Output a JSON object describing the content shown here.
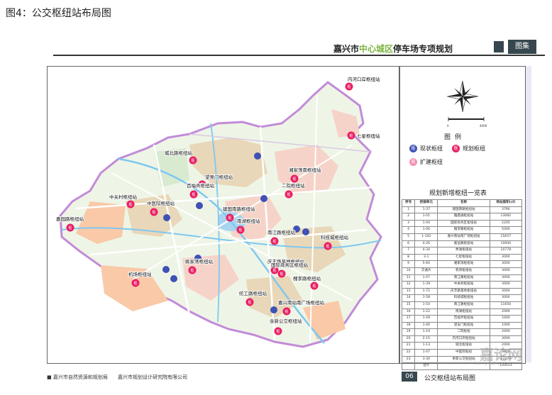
{
  "caption": "图4：公交枢纽站布局图",
  "header": {
    "title_prefix": "嘉兴市",
    "title_highlight": "中心城区",
    "title_suffix": "停车场专项规划",
    "tab_label": "图集",
    "highlight_color": "#7cb342",
    "dark_color": "#37474f"
  },
  "compass": {
    "scale_left": "0",
    "scale_right": "4000"
  },
  "legend": {
    "title": "图例",
    "items": [
      {
        "label": "现状枢纽",
        "color": "#3f51b5",
        "glyph": "枢"
      },
      {
        "label": "规划枢纽",
        "color": "#e91e63",
        "glyph": "枢"
      },
      {
        "label": "扩建枢纽",
        "color": "#f48fb1",
        "glyph": "枢"
      }
    ]
  },
  "table": {
    "title": "规划新增枢纽一览表",
    "columns": [
      "序号",
      "控规单元",
      "名称",
      "场站面积(㎡)"
    ],
    "rows": [
      [
        "1",
        "1-37",
        "建国南路枢纽站",
        "3790"
      ],
      [
        "2",
        "1-01",
        "雅鹿通枢纽站",
        "13082"
      ],
      [
        "3",
        "1-04",
        "国际商务区枢纽站",
        "2205"
      ],
      [
        "4",
        "1-06",
        "槐李路枢纽站",
        "5000"
      ],
      [
        "5",
        "1-102",
        "嘉兴南站南广场枢纽站",
        "15657"
      ],
      [
        "6",
        "4-26",
        "嘉运路枢纽站",
        "10000"
      ],
      [
        "7",
        "4-34",
        "秀湖枢纽站",
        "10778"
      ],
      [
        "8",
        "3-1",
        "七星枢纽站",
        "3000"
      ],
      [
        "9",
        "5-60",
        "湘家荡枢纽站",
        "3000"
      ],
      [
        "10",
        "交通片",
        "机场枢纽站",
        "3000"
      ],
      [
        "11",
        "1-07",
        "南江路枢纽站",
        "3000"
      ],
      [
        "12",
        "1-39",
        "中关村枢纽站",
        "3000"
      ],
      [
        "13",
        "1-72",
        "庆丰路基地枢纽站",
        "3000"
      ],
      [
        "14",
        "1-58",
        "科技城枢纽站",
        "3000"
      ],
      [
        "15",
        "1-54",
        "南江路枢纽站",
        "11650"
      ],
      [
        "16",
        "1-22",
        "南湖枢纽站",
        "2000"
      ],
      [
        "17",
        "1-49",
        "百福弄枢纽站",
        "1000"
      ],
      [
        "18",
        "1-40",
        "望吴门枢纽站",
        "1000"
      ],
      [
        "19",
        "1-10",
        "二院枢纽",
        "2000"
      ],
      [
        "20",
        "2-15",
        "内河口岸枢纽站",
        "3000"
      ],
      [
        "21",
        "1-13",
        "城北枢纽站",
        "2000"
      ],
      [
        "22",
        "1-47",
        "中医院枢纽",
        "3000"
      ],
      [
        "23",
        "3-30",
        "余新公交枢纽站",
        "23170"
      ],
      [
        "",
        "合计",
        "",
        "133513"
      ]
    ]
  },
  "map": {
    "stations": [
      {
        "label": "内河口岸枢纽站",
        "kind": "planned"
      },
      {
        "label": "七星枢纽站",
        "kind": "planned"
      },
      {
        "label": "城北路枢纽站",
        "kind": "planned"
      },
      {
        "label": "湘家荡南枢纽站",
        "kind": "planned"
      },
      {
        "label": "望吴门枢纽站",
        "kind": "planned"
      },
      {
        "label": "百福弄枢纽站",
        "kind": "planned"
      },
      {
        "label": "二院枢纽站",
        "kind": "planned"
      },
      {
        "label": "中关村枢纽站",
        "kind": "planned"
      },
      {
        "label": "中医院枢纽站",
        "kind": "planned"
      },
      {
        "label": "建国南路枢纽站",
        "kind": "planned"
      },
      {
        "label": "南湖枢纽站",
        "kind": "planned"
      },
      {
        "label": "嘉园路枢纽站",
        "kind": "planned"
      },
      {
        "label": "科技城枢纽站",
        "kind": "planned"
      },
      {
        "label": "南江路枢纽站",
        "kind": "planned"
      },
      {
        "label": "庆丰路基地枢纽站",
        "kind": "planned"
      },
      {
        "label": "姚家荡枢纽站",
        "kind": "planned"
      },
      {
        "label": "国际商务区枢纽站",
        "kind": "planned"
      },
      {
        "label": "机场枢纽站",
        "kind": "planned"
      },
      {
        "label": "槐李路枢纽站",
        "kind": "planned"
      },
      {
        "label": "纺工路枢纽站",
        "kind": "planned"
      },
      {
        "label": "嘉兴南站南广场枢纽站",
        "kind": "planned"
      },
      {
        "label": "余新公交枢纽站",
        "kind": "planned"
      }
    ],
    "marker_glyph": "枢"
  },
  "footer": {
    "org_left": "嘉兴市自然资源和规划局",
    "org_right": "嘉兴市规划设计研究院有限公司",
    "page_number": "06",
    "page_title": "公交枢纽站布局图"
  },
  "watermark": {
    "main": "嘉论网",
    "sub": "www.jxlun.com"
  }
}
